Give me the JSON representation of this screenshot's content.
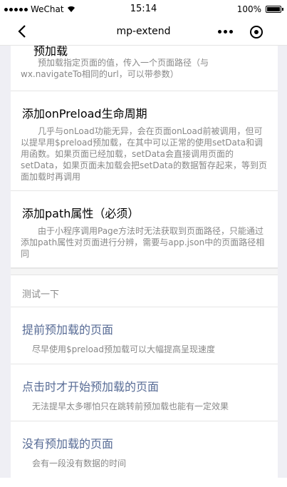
{
  "status": {
    "carrier": "WeChat",
    "time": "15:14",
    "battery": "100%",
    "battery_level": 1.0
  },
  "nav": {
    "title": "mp-extend"
  },
  "sections": [
    {
      "title": "预加载",
      "desc": "预加载指定页面的值，传入一个页面路径（与wx.navigateTo相同的url，可以带参数）"
    },
    {
      "title": "添加onPreload生命周期",
      "desc": "几乎与onLoad功能无异，会在页面onLoad前被调用，但可以提早用$preload预加载，在其中可以正常的使用setData和调用函数。如果页面已经加载，setData会直接调用页面的setData，如果页面未加载会把setData的数据暂存起来，等到页面加载时再调用"
    },
    {
      "title": "添加path属性（必须）",
      "desc": "由于小程序调用Page方法时无法获取到页面路径，只能通过添加path属性对页面进行分辨，需要与app.json中的页面路径相同"
    }
  ],
  "test": {
    "label": "测试一下",
    "items": [
      {
        "title": "提前预加载的页面",
        "desc": "尽早使用$preload预加载可以大幅提高呈现速度"
      },
      {
        "title": "点击时才开始预加载的页面",
        "desc": "无法提早太多哪怕只在跳转前预加载也能有一定效果"
      },
      {
        "title": "没有预加载的页面",
        "desc": "会有一段没有数据的时间"
      }
    ]
  }
}
